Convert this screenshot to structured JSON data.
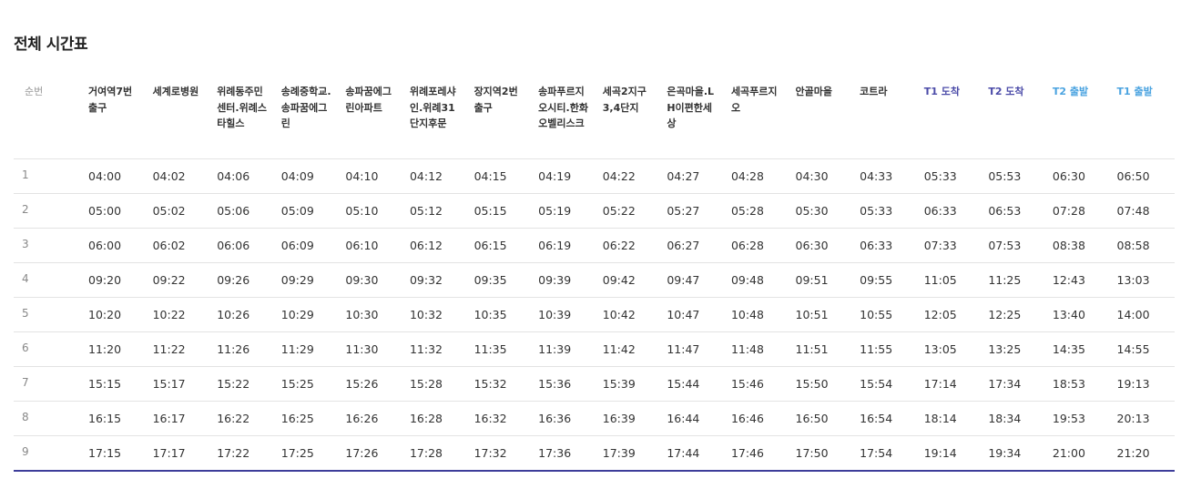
{
  "title": "전체 시간표",
  "colors": {
    "arrive_header": "#4b4ba8",
    "depart_header": "#4aa3e0",
    "bottom_border": "#3d3d9a"
  },
  "headers": {
    "index": "순번",
    "stops": [
      "거여역7번 출구",
      "세계로병원",
      "위례동주민센터.위례스타힐스",
      "송례중학교.송파꿈에그린",
      "송파꿈에그린아파트",
      "위례포레샤인.위례31단지후문",
      "장지역2번 출구",
      "송파푸르지오시티.한화오벨리스크",
      "세곡2지구3,4단지",
      "은곡마을.LH이편한세상",
      "세곡푸르지오",
      "안골마을",
      "코트라",
      "T1 도착",
      "T2 도착",
      "T2 출발",
      "T1 출발"
    ]
  },
  "rows": [
    {
      "index": "1",
      "times": [
        "04:00",
        "04:02",
        "04:06",
        "04:09",
        "04:10",
        "04:12",
        "04:15",
        "04:19",
        "04:22",
        "04:27",
        "04:28",
        "04:30",
        "04:33",
        "05:33",
        "05:53",
        "06:30",
        "06:50"
      ]
    },
    {
      "index": "2",
      "times": [
        "05:00",
        "05:02",
        "05:06",
        "05:09",
        "05:10",
        "05:12",
        "05:15",
        "05:19",
        "05:22",
        "05:27",
        "05:28",
        "05:30",
        "05:33",
        "06:33",
        "06:53",
        "07:28",
        "07:48"
      ]
    },
    {
      "index": "3",
      "times": [
        "06:00",
        "06:02",
        "06:06",
        "06:09",
        "06:10",
        "06:12",
        "06:15",
        "06:19",
        "06:22",
        "06:27",
        "06:28",
        "06:30",
        "06:33",
        "07:33",
        "07:53",
        "08:38",
        "08:58"
      ]
    },
    {
      "index": "4",
      "times": [
        "09:20",
        "09:22",
        "09:26",
        "09:29",
        "09:30",
        "09:32",
        "09:35",
        "09:39",
        "09:42",
        "09:47",
        "09:48",
        "09:51",
        "09:55",
        "11:05",
        "11:25",
        "12:43",
        "13:03"
      ]
    },
    {
      "index": "5",
      "times": [
        "10:20",
        "10:22",
        "10:26",
        "10:29",
        "10:30",
        "10:32",
        "10:35",
        "10:39",
        "10:42",
        "10:47",
        "10:48",
        "10:51",
        "10:55",
        "12:05",
        "12:25",
        "13:40",
        "14:00"
      ]
    },
    {
      "index": "6",
      "times": [
        "11:20",
        "11:22",
        "11:26",
        "11:29",
        "11:30",
        "11:32",
        "11:35",
        "11:39",
        "11:42",
        "11:47",
        "11:48",
        "11:51",
        "11:55",
        "13:05",
        "13:25",
        "14:35",
        "14:55"
      ]
    },
    {
      "index": "7",
      "times": [
        "15:15",
        "15:17",
        "15:22",
        "15:25",
        "15:26",
        "15:28",
        "15:32",
        "15:36",
        "15:39",
        "15:44",
        "15:46",
        "15:50",
        "15:54",
        "17:14",
        "17:34",
        "18:53",
        "19:13"
      ]
    },
    {
      "index": "8",
      "times": [
        "16:15",
        "16:17",
        "16:22",
        "16:25",
        "16:26",
        "16:28",
        "16:32",
        "16:36",
        "16:39",
        "16:44",
        "16:46",
        "16:50",
        "16:54",
        "18:14",
        "18:34",
        "19:53",
        "20:13"
      ]
    },
    {
      "index": "9",
      "times": [
        "17:15",
        "17:17",
        "17:22",
        "17:25",
        "17:26",
        "17:28",
        "17:32",
        "17:36",
        "17:39",
        "17:44",
        "17:46",
        "17:50",
        "17:54",
        "19:14",
        "19:34",
        "21:00",
        "21:20"
      ]
    }
  ]
}
